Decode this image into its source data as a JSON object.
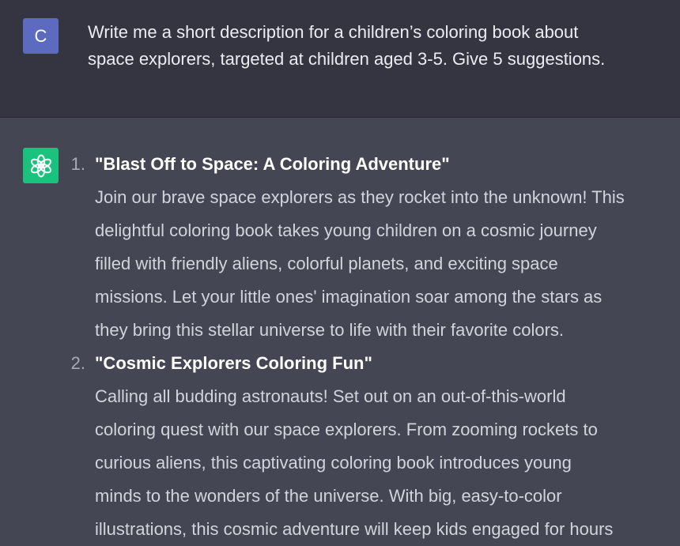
{
  "user": {
    "avatar_letter": "C",
    "message_lines": [
      "Write me a short description for a children’s coloring book about",
      "space explorers, targeted at children aged 3-5. Give 5 suggestions."
    ]
  },
  "assistant": {
    "avatar_icon": "openai-logo-icon",
    "items": [
      {
        "number": "1.",
        "title": "\"Blast Off to Space: A Coloring Adventure\"",
        "lines": [
          "Join our brave space explorers as they rocket into the unknown! This",
          "delightful coloring book takes young children on a cosmic journey",
          "filled with friendly aliens, colorful planets, and exciting space",
          "missions. Let your little ones' imagination soar among the stars as",
          "they bring this stellar universe to life with their favorite colors."
        ]
      },
      {
        "number": "2.",
        "title": "\"Cosmic Explorers Coloring Fun\"",
        "lines": [
          "Calling all budding astronauts! Set out on an out-of-this-world",
          "coloring quest with our space explorers. From zooming rockets to",
          "curious aliens, this captivating coloring book introduces young",
          "minds to the wonders of the universe. With big, easy-to-color",
          "illustrations, this cosmic adventure will keep kids engaged for hours"
        ]
      }
    ]
  },
  "colors": {
    "user_bg": "#343541",
    "assistant_bg": "#444654",
    "user_avatar_bg": "#5c6bc0",
    "assistant_avatar_bg": "#19c37d"
  }
}
